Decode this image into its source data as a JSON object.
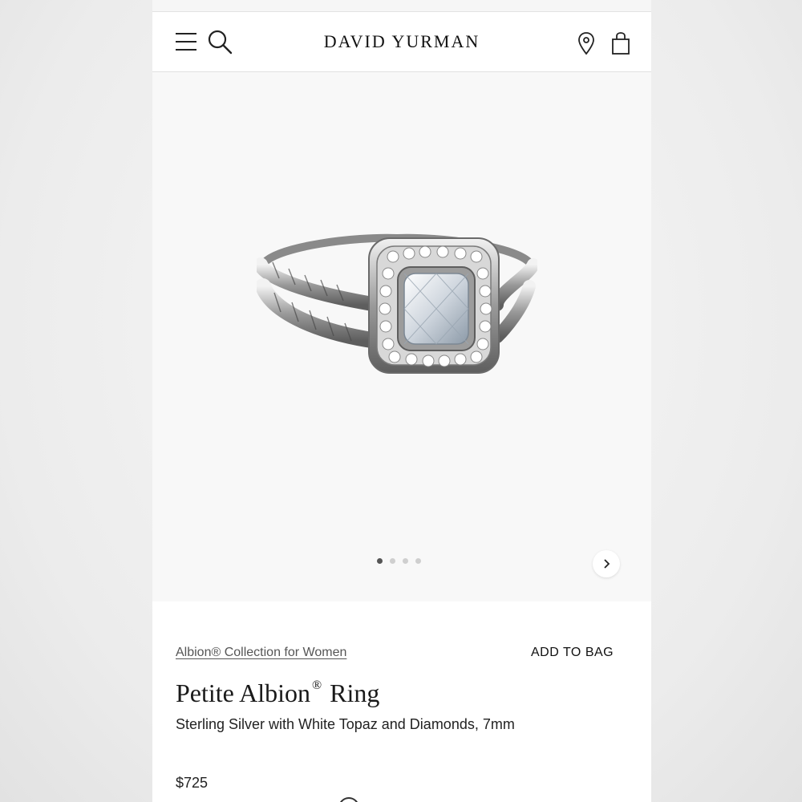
{
  "header": {
    "brand": "DAVID YURMAN",
    "icons": [
      "menu-icon",
      "search-icon",
      "location-icon",
      "shopping-bag-icon"
    ]
  },
  "gallery": {
    "image_description": "silver ring with cushion-cut white topaz and diamond halo",
    "dots_total": 4,
    "active_dot": 1,
    "next_icon": "chevron-right-icon"
  },
  "product": {
    "collection_link": "Albion® Collection for Women",
    "add_to_bag": "ADD TO BAG",
    "title_main": "Petite Albion",
    "title_reg": "®",
    "title_end": "Ring",
    "subtitle": "Sterling Silver with White Topaz and Diamonds, 7mm",
    "price": "$725"
  }
}
